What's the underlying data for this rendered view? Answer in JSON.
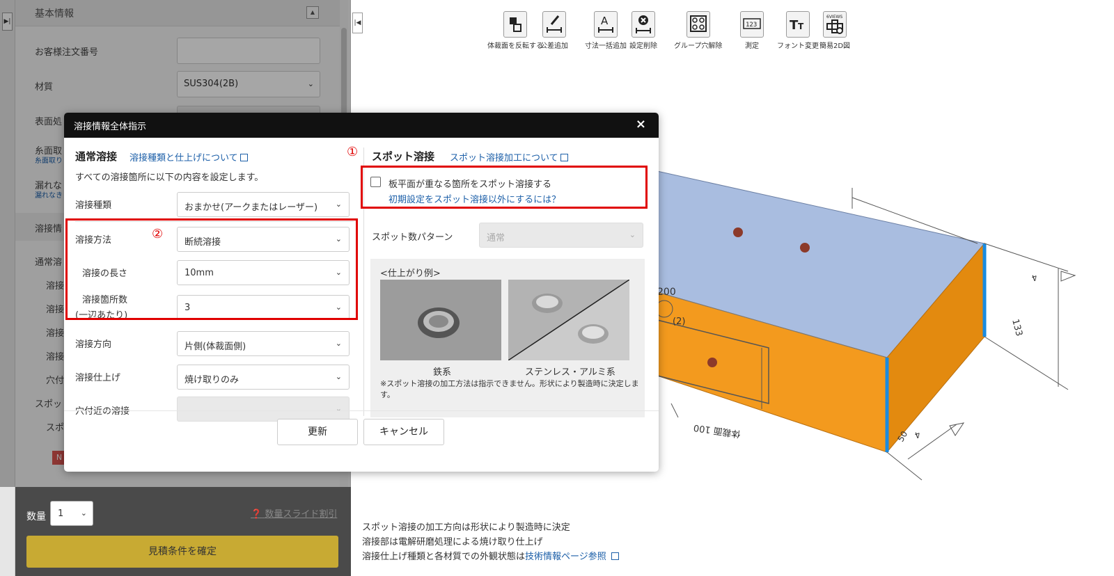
{
  "left_panel": {
    "section_title": "基本情報",
    "fields": [
      {
        "label": "お客様注文番号",
        "value": ""
      },
      {
        "label": "材質",
        "value": "SUS304(2B)"
      },
      {
        "label": "表面処",
        "value": ""
      },
      {
        "label": "糸面取",
        "sub": "糸面取り"
      },
      {
        "label": "漏れな",
        "sub": "漏れなき"
      }
    ],
    "weld_section": "溶接情",
    "weld_items": [
      "通常溶",
      "溶接",
      "溶接",
      "溶接",
      "溶接",
      "穴付",
      "スポッ",
      "スポ"
    ],
    "badge": "N",
    "quantity_label": "数量",
    "quantity_value": "1",
    "quantity_help": "数量スライド割引",
    "confirm_button": "見積条件を確定"
  },
  "toolbar": {
    "items": [
      {
        "label": "体裁面を反転する",
        "icon": "flip-icon"
      },
      {
        "label": "公差追加",
        "icon": "tolerance-icon"
      },
      {
        "label": "寸法一括追加",
        "icon": "dimension-icon"
      },
      {
        "label": "設定削除",
        "icon": "delete-setting-icon"
      },
      {
        "label": "グループ穴解除",
        "icon": "group-hole-icon"
      },
      {
        "label": "測定",
        "icon": "measure-icon"
      },
      {
        "label": "フォント変更",
        "icon": "font-icon"
      },
      {
        "label": "簡易2D図",
        "icon": "six-views-icon",
        "badge": "6VIEWS"
      }
    ]
  },
  "viewer": {
    "dim_200": "200",
    "dim_2": "(2)",
    "dim_133": "133",
    "dim_100_face": "体裁面 100",
    "dim_50": "50",
    "dim_4a": "4",
    "dim_4b": "4"
  },
  "info": {
    "line1": "スポット溶接の加工方向は形状により製造時に決定",
    "line2": "溶接部は電解研磨処理による焼け取り仕上げ",
    "line3_text": "溶接仕上げ種類と各材質での外観状態は",
    "line3_link": "技術情報ページ参照"
  },
  "modal": {
    "title": "溶接情報全体指示",
    "close": "×",
    "normal": {
      "title": "通常溶接",
      "link": "溶接種類と仕上げについて",
      "desc": "すべての溶接箇所に以下の内容を設定します。",
      "rows": [
        {
          "label": "溶接種類",
          "value": "おまかせ(アークまたはレーザー)"
        },
        {
          "label": "溶接方法",
          "value": "断続溶接"
        },
        {
          "label": "溶接の長さ",
          "value": "10mm"
        },
        {
          "label": "溶接箇所数",
          "label2": "(一辺あたり)",
          "value": "3"
        },
        {
          "label": "溶接方向",
          "value": "片側(体裁面側)"
        },
        {
          "label": "溶接仕上げ",
          "value": "焼け取りのみ"
        },
        {
          "label": "穴付近の溶接",
          "value": ""
        }
      ]
    },
    "spot": {
      "marker": "①",
      "title": "スポット溶接",
      "link": "スポット溶接加工について",
      "checkbox_label": "板平面が重なる箇所をスポット溶接する",
      "sub_link": "初期設定をスポット溶接以外にするには？",
      "pattern_label": "スポット数パターン",
      "pattern_value": "通常",
      "finish_title": "<仕上がり例>",
      "photo1_caption": "鉄系",
      "photo2_caption": "ステンレス・アルミ系",
      "note": "※スポット溶接の加工方法は指示できません。形状により製造時に決定します。"
    },
    "marker2": "②",
    "update_button": "更新",
    "cancel_button": "キャンセル"
  }
}
